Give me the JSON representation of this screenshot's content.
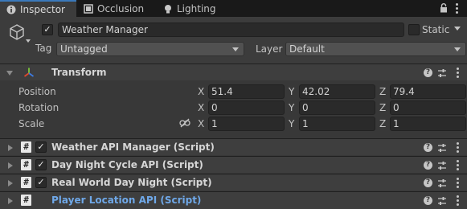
{
  "tabs": [
    {
      "label": "Inspector",
      "icon": "info-icon"
    },
    {
      "label": "Occlusion",
      "icon": "occlusion-icon"
    },
    {
      "label": "Lighting",
      "icon": "lightbulb-icon"
    }
  ],
  "tab_actions": {
    "lock_icon": "lock-icon",
    "menu_icon": "kebab-menu-icon"
  },
  "object": {
    "active_checked": true,
    "name": "Weather Manager",
    "static_label": "Static",
    "static_checked": false,
    "tag_label": "Tag",
    "tag_value": "Untagged",
    "layer_label": "Layer",
    "layer_value": "Default"
  },
  "transform": {
    "title": "Transform",
    "rows": [
      {
        "label": "Position",
        "x": "51.4",
        "y": "42.02",
        "z": "79.4"
      },
      {
        "label": "Rotation",
        "x": "0",
        "y": "0",
        "z": "0"
      },
      {
        "label": "Scale",
        "x": "1",
        "y": "1",
        "z": "1"
      }
    ],
    "axis_labels": {
      "x": "X",
      "y": "Y",
      "z": "Z"
    }
  },
  "components": [
    {
      "title": "Weather API Manager (Script)",
      "enabled": true,
      "has_checkbox": true,
      "highlight": false
    },
    {
      "title": "Day Night Cycle API (Script)",
      "enabled": true,
      "has_checkbox": true,
      "highlight": false
    },
    {
      "title": "Real World Day Night (Script)",
      "enabled": true,
      "has_checkbox": true,
      "highlight": false
    },
    {
      "title": "Player Location API (Script)",
      "enabled": false,
      "has_checkbox": false,
      "highlight": true
    }
  ],
  "colors": {
    "accent": "#3a79bb",
    "link_blue": "#6fa8e8",
    "background": "#383838"
  }
}
